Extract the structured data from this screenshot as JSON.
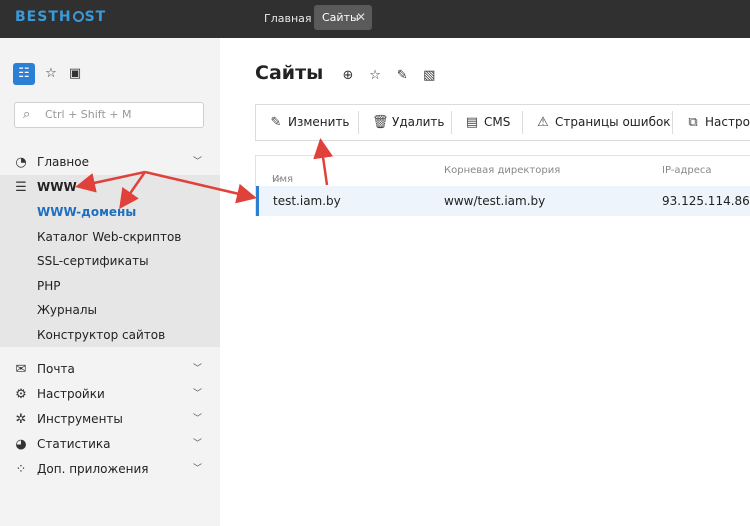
{
  "header": {
    "logo": "BESTHOST",
    "tabs": [
      {
        "label": "Главная"
      },
      {
        "label": "Сайты",
        "close": "✕"
      }
    ]
  },
  "sidebar": {
    "search_placeholder": "Ctrl + Shift + M",
    "nav": [
      {
        "label": "Главное",
        "icon": "gauge-icon"
      },
      {
        "label": "WWW",
        "icon": "sliders-icon"
      }
    ],
    "sub": [
      {
        "label": "WWW-домены"
      },
      {
        "label": "Каталог Web-скриптов"
      },
      {
        "label": "SSL-сертификаты"
      },
      {
        "label": "PHP"
      },
      {
        "label": "Журналы"
      },
      {
        "label": "Конструктор сайтов"
      }
    ],
    "nav2": [
      {
        "label": "Почта",
        "icon": "mail-icon"
      },
      {
        "label": "Настройки",
        "icon": "gear-icon"
      },
      {
        "label": "Инструменты",
        "icon": "tools-icon"
      },
      {
        "label": "Статистика",
        "icon": "pie-icon"
      },
      {
        "label": "Доп. приложения",
        "icon": "apps-icon"
      }
    ]
  },
  "main": {
    "title": "Сайты",
    "toolbar": [
      {
        "label": "Изменить",
        "icon": "pencil-icon"
      },
      {
        "label": "Удалить",
        "icon": "trash-icon"
      },
      {
        "label": "CMS",
        "icon": "cms-icon"
      },
      {
        "label": "Страницы ошибок",
        "icon": "error-page-icon"
      },
      {
        "label": "Настро",
        "icon": "settings-page-icon"
      }
    ],
    "table": {
      "columns": [
        "Имя",
        "Корневая директория",
        "IP-адреса"
      ],
      "rows": [
        {
          "name": "test.iam.by",
          "root": "www/test.iam.by",
          "ip": "93.125.114.86"
        }
      ]
    }
  },
  "colors": {
    "accent": "#2b7fd4",
    "topbar": "#303030",
    "arrow": "#e0413a"
  }
}
